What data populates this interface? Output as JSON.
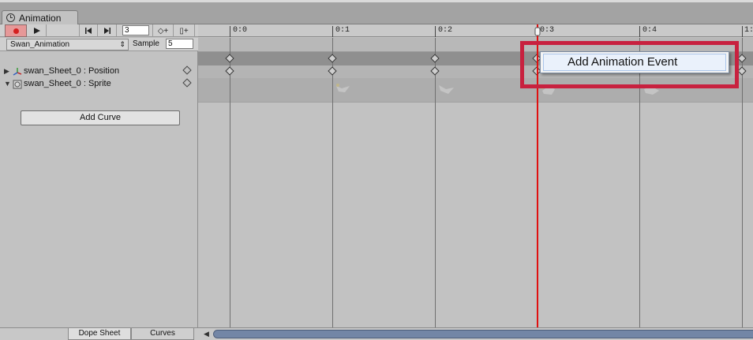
{
  "window": {
    "tab_label": "Animation",
    "tab_icon": "clock-icon"
  },
  "toolbar": {
    "record_icon": "record-icon",
    "play_icon": "play-icon",
    "prev_key_icon": "prev-key-icon",
    "next_key_icon": "next-key-icon",
    "frame_value": "3",
    "add_key_glyph": "◇+",
    "add_event_glyph": "▯+"
  },
  "clip": {
    "name": "Swan_Animation",
    "sample_label": "Sample",
    "sample_value": "5"
  },
  "properties": [
    {
      "label": "swan_Sheet_0 : Position",
      "expanded": false,
      "icon": "transform-icon"
    },
    {
      "label": "swan_Sheet_0 : Sprite",
      "expanded": true,
      "icon": "sprite-renderer-icon"
    }
  ],
  "add_curve_label": "Add Curve",
  "view_tabs": {
    "dope_sheet": "Dope Sheet",
    "curves": "Curves"
  },
  "timeline": {
    "ticks": [
      "0:0",
      "0:1",
      "0:2",
      "0:3",
      "0:4",
      "1:"
    ],
    "current_time": "0:3",
    "playhead_color": "#e01010"
  },
  "context_menu": {
    "item_label": "Add Animation Event"
  },
  "colors": {
    "highlight_border": "#c8213f",
    "record_bg": "#e69898",
    "scroll_thumb": "#7386a6"
  }
}
